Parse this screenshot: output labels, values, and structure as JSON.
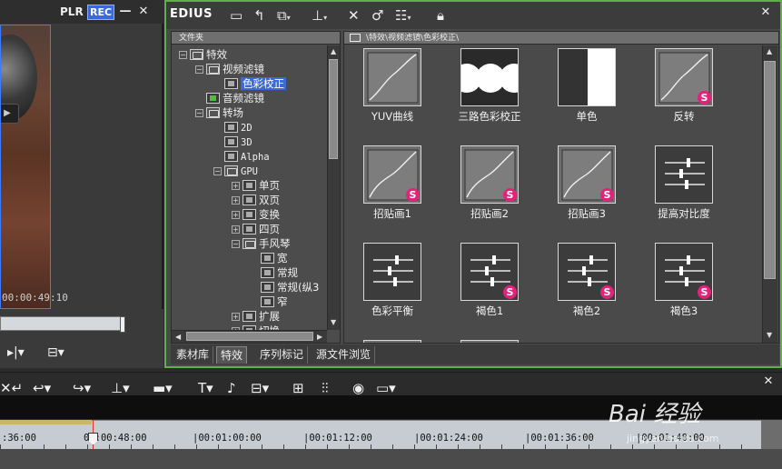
{
  "player": {
    "plr_label": "PLR",
    "rec_label": "REC",
    "minimize": "—",
    "close": "✕",
    "timecode": "00:00:49:10"
  },
  "effect_panel": {
    "app_name": "EDIUS",
    "tree_header": "文件夹",
    "tree": [
      {
        "label": "特效",
        "level": 0,
        "expander": "−",
        "icon": "folder"
      },
      {
        "label": "视频滤镜",
        "level": 1,
        "expander": "−",
        "icon": "folder"
      },
      {
        "label": "色彩校正",
        "level": 2,
        "expander": "",
        "icon": "fx",
        "selected": true
      },
      {
        "label": "音频滤镜",
        "level": 1,
        "expander": "",
        "icon": "fx-green"
      },
      {
        "label": "转场",
        "level": 1,
        "expander": "−",
        "icon": "folder"
      },
      {
        "label": "2D",
        "level": 2,
        "expander": "",
        "icon": "fx",
        "mono": true
      },
      {
        "label": "3D",
        "level": 2,
        "expander": "",
        "icon": "fx",
        "mono": true
      },
      {
        "label": "Alpha",
        "level": 2,
        "expander": "",
        "icon": "fx",
        "mono": true
      },
      {
        "label": "GPU",
        "level": 2,
        "expander": "−",
        "icon": "folder",
        "mono": true
      },
      {
        "label": "单页",
        "level": 3,
        "expander": "+",
        "icon": "fx"
      },
      {
        "label": "双页",
        "level": 3,
        "expander": "+",
        "icon": "fx"
      },
      {
        "label": "变换",
        "level": 3,
        "expander": "+",
        "icon": "fx"
      },
      {
        "label": "四页",
        "level": 3,
        "expander": "+",
        "icon": "fx"
      },
      {
        "label": "手风琴",
        "level": 3,
        "expander": "−",
        "icon": "folder"
      },
      {
        "label": "宽",
        "level": 4,
        "expander": "",
        "icon": "fx"
      },
      {
        "label": "常规",
        "level": 4,
        "expander": "",
        "icon": "fx"
      },
      {
        "label": "常规(纵3",
        "level": 4,
        "expander": "",
        "icon": "fx"
      },
      {
        "label": "窄",
        "level": 4,
        "expander": "",
        "icon": "fx"
      },
      {
        "label": "扩展",
        "level": 3,
        "expander": "+",
        "icon": "fx"
      },
      {
        "label": "切换",
        "level": 3,
        "expander": "+",
        "icon": "fx"
      }
    ],
    "grid_header": "\\特效\\视频滤镜\\色彩校正\\",
    "effects": [
      {
        "label": "YUV曲线",
        "kind": "curve",
        "badge": ""
      },
      {
        "label": "三路色彩校正",
        "kind": "circles",
        "badge": ""
      },
      {
        "label": "单色",
        "kind": "mono",
        "badge": ""
      },
      {
        "label": "反转",
        "kind": "curve",
        "badge": "S"
      },
      {
        "label": "招贴画1",
        "kind": "curve2",
        "badge": "S"
      },
      {
        "label": "招贴画2",
        "kind": "curve2",
        "badge": "S"
      },
      {
        "label": "招贴画3",
        "kind": "curve2",
        "badge": "S"
      },
      {
        "label": "提高对比度",
        "kind": "sliders",
        "badge": ""
      },
      {
        "label": "色彩平衡",
        "kind": "sliders",
        "badge": ""
      },
      {
        "label": "褐色1",
        "kind": "sliders",
        "badge": "S"
      },
      {
        "label": "褐色2",
        "kind": "sliders",
        "badge": "S"
      },
      {
        "label": "褐色3",
        "kind": "sliders",
        "badge": "S"
      }
    ],
    "tabs": [
      {
        "label": "素材库",
        "active": false
      },
      {
        "label": "特效",
        "active": true
      },
      {
        "label": "序列标记",
        "active": false
      },
      {
        "label": "源文件浏览",
        "active": false
      }
    ],
    "close": "✕"
  },
  "timeline": {
    "close": "✕",
    "ruler_labels": [
      ":36:00",
      "00:00:48:00",
      "|00:01:00:00",
      "|00:01:12:00",
      "|00:01:24:00",
      "|00:01:36:00",
      "|00:01:48:00"
    ]
  },
  "watermark": {
    "text": "Bai 经验",
    "url": "jingyan.baidu.com"
  },
  "colors": {
    "accent_blue": "#3b6ad8",
    "panel_border_green": "#5fb04a",
    "badge_pink": "#e3227a",
    "cursor_red": "#e53030"
  }
}
